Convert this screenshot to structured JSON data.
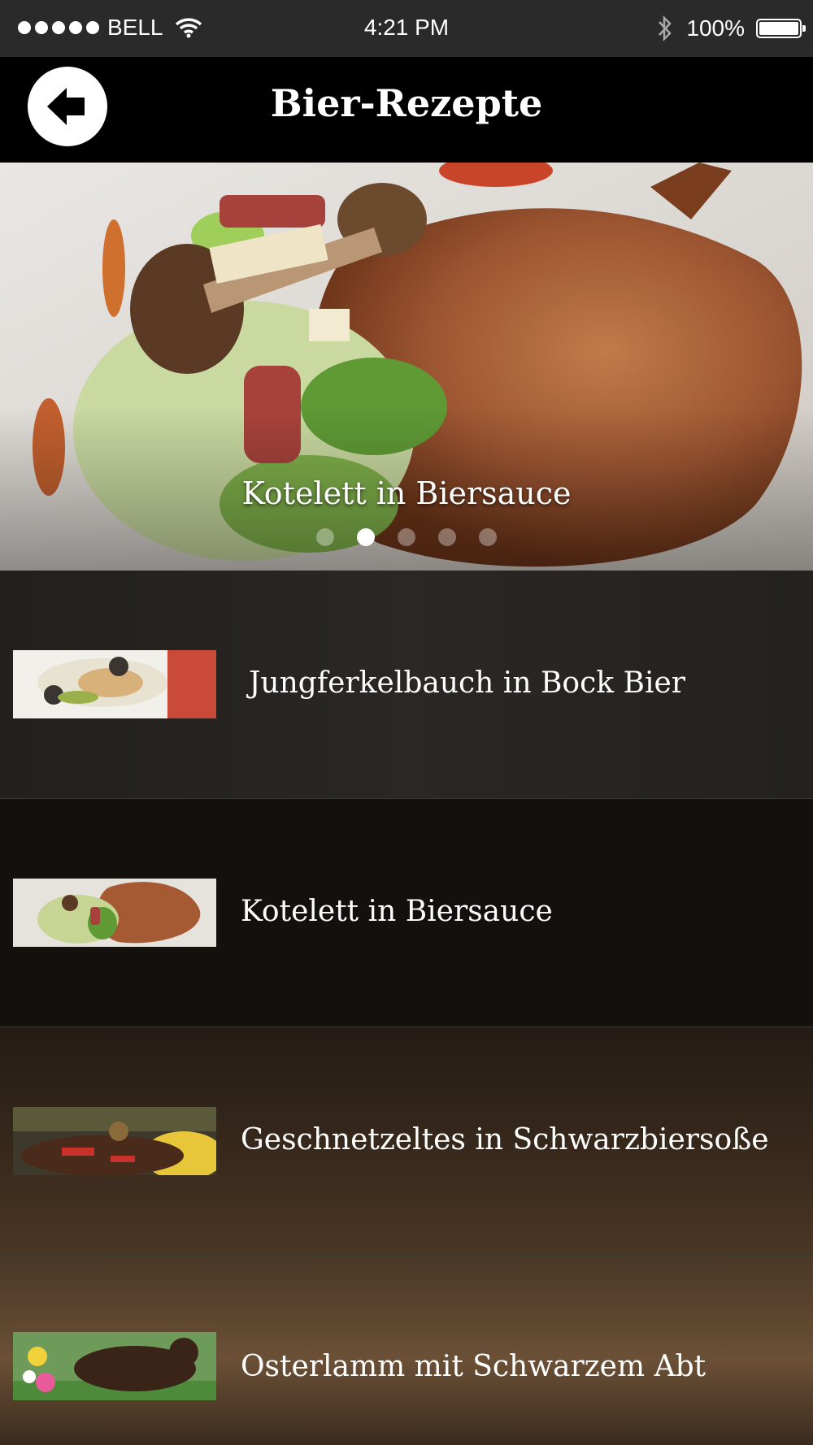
{
  "status_bar": {
    "carrier": "BELL",
    "time": "4:21 PM",
    "battery": "100%"
  },
  "nav": {
    "title": "Bier-Rezepte",
    "back_icon": "back-arrow-icon"
  },
  "hero": {
    "caption": "Kotelett in Biersauce",
    "page_count": 5,
    "active_page": 2
  },
  "recipes": [
    {
      "title": "Jungferkelbauch in Bock Bier"
    },
    {
      "title": "Kotelett in Biersauce"
    },
    {
      "title": "Geschnetzeltes in Schwarzbiersoße"
    },
    {
      "title": "Osterlamm mit Schwarzem Abt"
    }
  ],
  "colors": {
    "status_bar_bg": "#2a2a2a",
    "nav_bg": "#000000",
    "list_bg": "#14110f",
    "text": "#ffffff"
  }
}
